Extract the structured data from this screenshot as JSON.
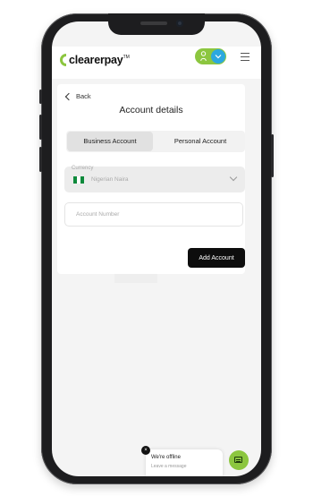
{
  "header": {
    "logo_text": "clearerpay",
    "logo_tm": "TM",
    "brand_green": "#8cc63f",
    "avatar_blue": "#2ba8df"
  },
  "nav": {
    "back_label": "Back"
  },
  "page": {
    "title": "Account details"
  },
  "tabs": [
    {
      "label": "Business Account",
      "active": true
    },
    {
      "label": "Personal Account",
      "active": false
    }
  ],
  "currency": {
    "label": "Currency",
    "value": "Nigerian Naira",
    "flag_icon": "nigeria-flag-icon"
  },
  "account_number": {
    "placeholder": "Account Number",
    "value": ""
  },
  "actions": {
    "add_account_label": "Add Account"
  },
  "chat": {
    "status": "We're offline",
    "subtitle": "Leave a message",
    "close_symbol": "×"
  }
}
